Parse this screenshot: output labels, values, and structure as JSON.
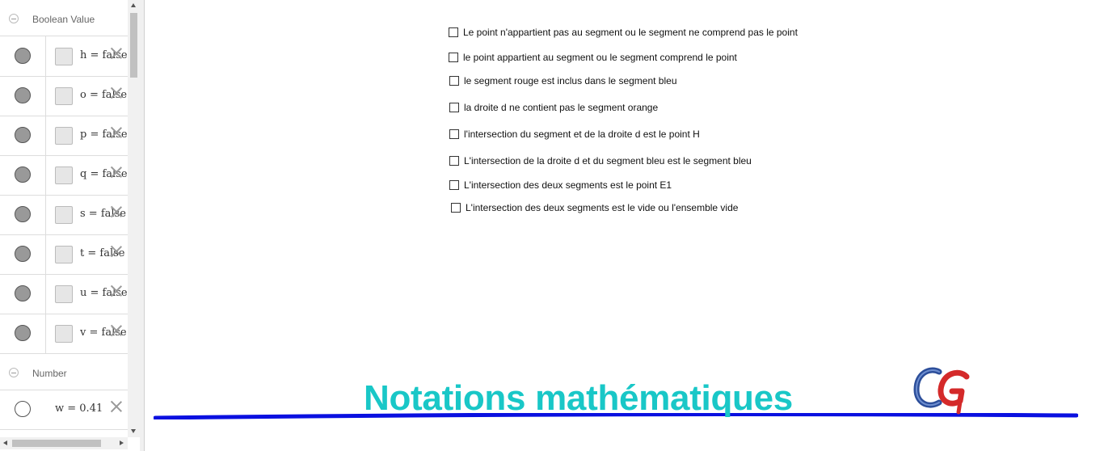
{
  "algebra": {
    "groups": {
      "boolean": "Boolean Value",
      "number": "Number"
    },
    "booleans": [
      {
        "expr": "h = false"
      },
      {
        "expr": "o = false"
      },
      {
        "expr": "p = false"
      },
      {
        "expr": "q = false"
      },
      {
        "expr": "s = false"
      },
      {
        "expr": "t = false"
      },
      {
        "expr": "u = false"
      },
      {
        "expr": "v = false"
      }
    ],
    "numbers": [
      {
        "expr": "w = 0.41"
      }
    ]
  },
  "checkboxes": [
    {
      "label": "Le point n'appartient pas au segment ou le segment ne comprend pas le point",
      "checked": false
    },
    {
      "label": "le point appartient au segment ou le segment comprend le point",
      "checked": false
    },
    {
      "label": "le segment rouge est inclus dans le segment bleu",
      "checked": false
    },
    {
      "label": "la droite d ne contient pas le segment orange",
      "checked": false
    },
    {
      "label": "l'intersection du segment et de la droite d est le point H",
      "checked": false
    },
    {
      "label": "L'intersection de la droite d et du segment bleu est le segment bleu",
      "checked": false
    },
    {
      "label": "L'intersection des deux segments est le point E1",
      "checked": false
    },
    {
      "label": "L'intersection des deux segments est le vide ou l'ensemble vide",
      "checked": false
    }
  ],
  "graphics": {
    "title": "Notations mathématiques",
    "title_color": "#19c7c7",
    "line_color": "#0a10e0",
    "logo_icon": "cg-logo"
  }
}
